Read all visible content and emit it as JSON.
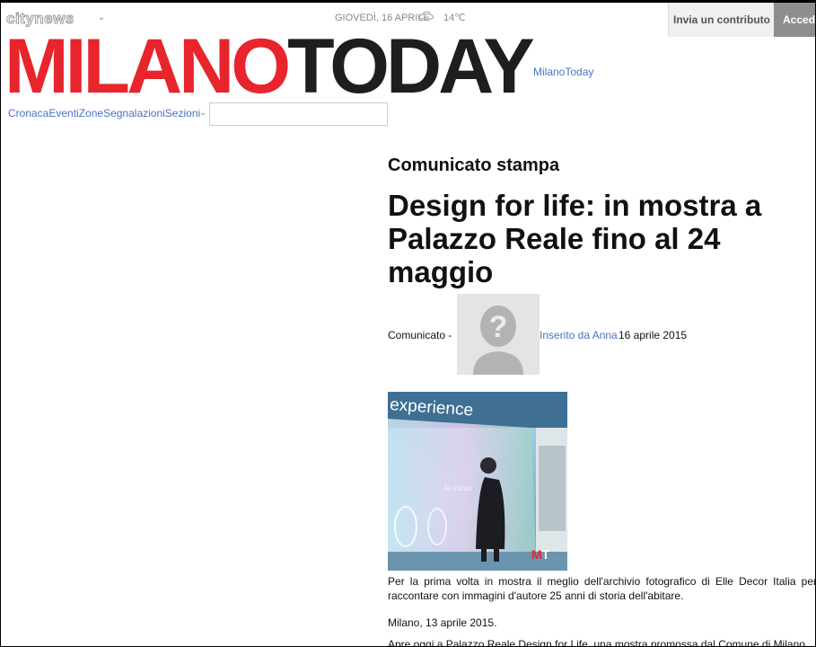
{
  "topbar": {
    "network_logo": "citynews",
    "date": "GIOVEDÌ, 16 APRILE",
    "temperature": "14℃",
    "contribute_button": "Invia un contributo",
    "login_button": "Accedi"
  },
  "logo": {
    "part_red": "MILANO",
    "part_black": "TODAY",
    "link_text": "MilanoToday"
  },
  "nav": {
    "items": [
      "Cronaca",
      "Eventi",
      "Zone",
      "Segnalazioni",
      "Sezioni"
    ],
    "search_placeholder": ""
  },
  "article": {
    "kicker": "Comunicato stampa",
    "headline": "Design for life: in mostra a Palazzo Reale fino al 24 maggio",
    "byline_prefix": "Comunicato -",
    "author": "Inserito da Anna",
    "date": "16 aprile 2015",
    "photo_text": "experience",
    "photo_badge_m": "M",
    "photo_badge_t": "T",
    "paragraphs": [
      "Per la prima volta in mostra il meglio dell'archivio fotografico di Elle Decor Italia per raccontare con immagini d'autore 25 anni di storia dell'abitare.",
      "Milano, 13 aprile 2015.",
      "Apre oggi a Palazzo Reale Design for Life, una mostra promossa dal Comune di Milano"
    ]
  },
  "colors": {
    "brand_red": "#e8242c",
    "link_blue": "#4a72c4"
  }
}
